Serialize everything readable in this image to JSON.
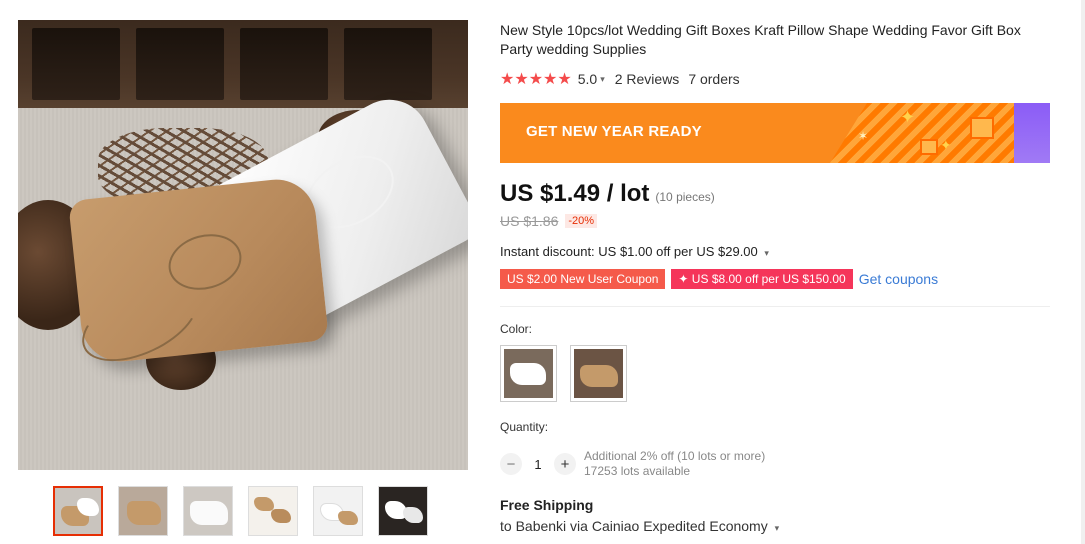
{
  "product": {
    "title": "New Style 10pcs/lot Wedding Gift Boxes Kraft Pillow Shape Wedding Favor Gift Box Party wedding Supplies",
    "rating": {
      "stars": "★★★★★",
      "score": "5.0",
      "reviews": "2 Reviews",
      "orders": "7 orders"
    }
  },
  "banner": {
    "text": "GET NEW YEAR READY"
  },
  "pricing": {
    "price": "US $1.49 / lot",
    "pieces": "(10 pieces)",
    "original_price": "US $1.86",
    "discount": "-20%",
    "instant_discount": "Instant discount: US $1.00 off per US $29.00"
  },
  "coupons": {
    "new_user": "US $2.00 New User Coupon",
    "store": "✦ US $8.00 off per US $150.00",
    "get_link": "Get coupons"
  },
  "options": {
    "color_label": "Color:",
    "quantity_label": "Quantity:",
    "quantity_value": "1",
    "minus": "−",
    "plus": "+",
    "additional_off": "Additional 2% off (10 lots or more)",
    "available": "17253 lots available"
  },
  "shipping": {
    "title": "Free Shipping",
    "detail": "to Babenki via Cainiao Expedited Economy"
  },
  "colors": {
    "accent_red": "#e62e04",
    "star_red": "#f44b4b",
    "banner_orange": "#fa8a1d",
    "link_blue": "#3a7bd5"
  }
}
